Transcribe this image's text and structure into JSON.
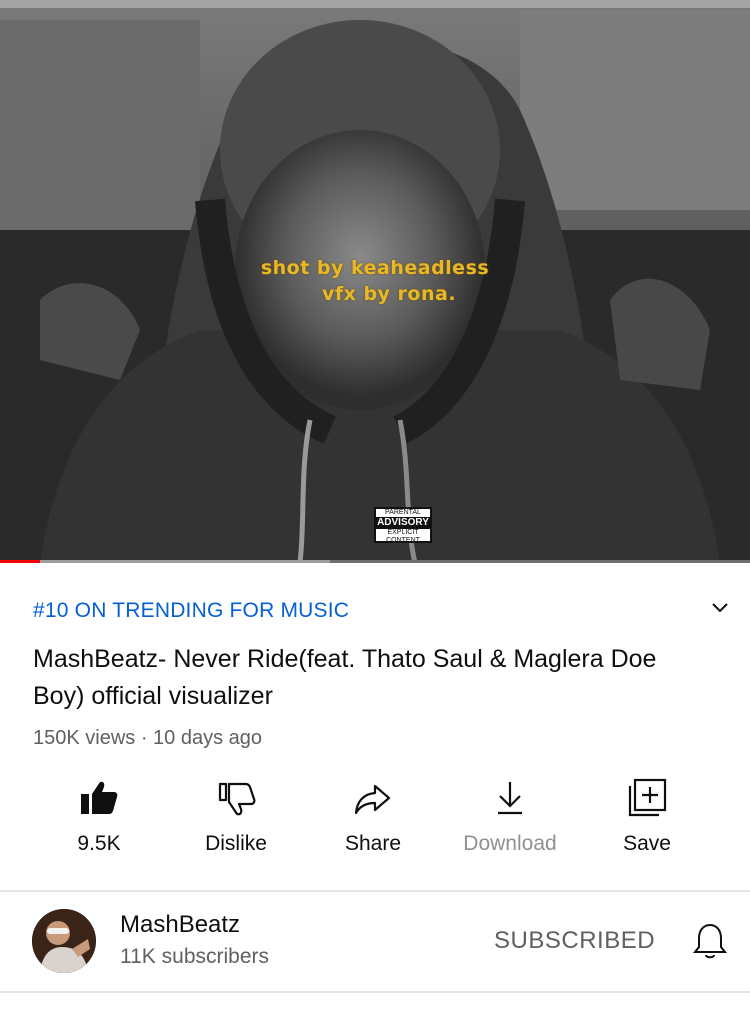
{
  "video": {
    "overlay_line1": "shot by keaheadless",
    "overlay_line2": "vfx by rona.",
    "advisory_top": "PARENTAL",
    "advisory_mid": "ADVISORY",
    "advisory_bottom": "EXPLICIT CONTENT",
    "progress_played_fraction": 0.053,
    "progress_buffered_fraction": 0.44
  },
  "info": {
    "trending_label": "#10 ON TRENDING FOR MUSIC",
    "title": "MashBeatz- Never Ride(feat. Thato Saul & Maglera Doe Boy) official visualizer",
    "meta": "150K views · 10 days ago",
    "expand_icon": "chevron-down-icon"
  },
  "actions": [
    {
      "label": "9.5K",
      "icon": "thumbs-up-icon"
    },
    {
      "label": "Dislike",
      "icon": "thumbs-down-icon"
    },
    {
      "label": "Share",
      "icon": "share-icon"
    },
    {
      "label": "Download",
      "icon": "download-icon",
      "disabled": true
    },
    {
      "label": "Save",
      "icon": "save-playlist-icon"
    }
  ],
  "channel": {
    "name": "MashBeatz",
    "subscribers": "11K subscribers",
    "subscribe_label": "SUBSCRIBED",
    "bell_icon": "bell-icon"
  },
  "colors": {
    "link_blue": "#065fd4",
    "progress_red": "#ff0000",
    "overlay_yellow": "#e8b829",
    "secondary_text": "#606060"
  }
}
